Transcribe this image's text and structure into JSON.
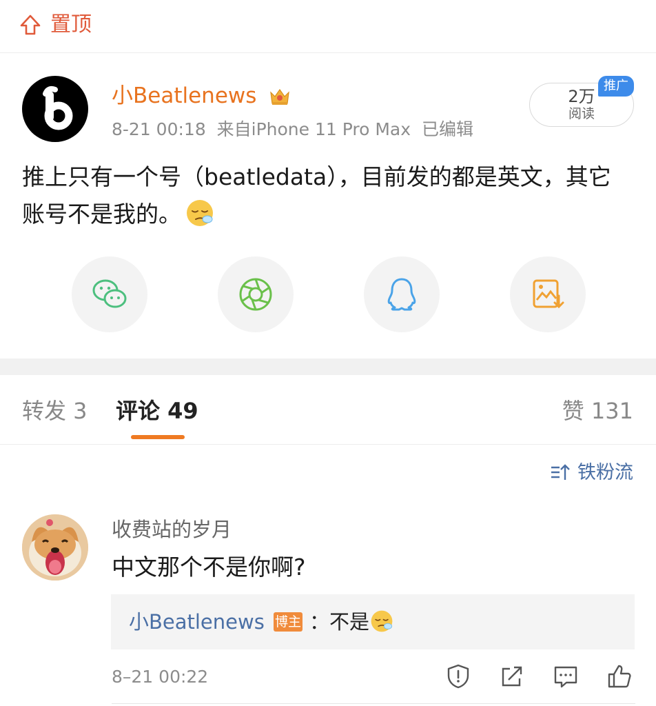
{
  "topbar": {
    "pin_label": "置顶"
  },
  "post": {
    "username": "小Beatlenews",
    "time": "8-21 00:18",
    "source": "来自iPhone 11 Pro Max",
    "edited": "已编辑",
    "views_count": "2万",
    "views_label": "阅读",
    "promo_badge": "推广",
    "body": "推上只有一个号（beatledata），目前发的都是英文，其它账号不是我的。"
  },
  "share": {
    "icons": [
      "wechat-icon",
      "moments-icon",
      "qq-icon",
      "save-image-icon"
    ]
  },
  "tabs": {
    "repost": "转发 3",
    "comments": "评论 49",
    "likes": "赞 131"
  },
  "sort": {
    "label": "铁粉流"
  },
  "comment": {
    "username": "收费站的岁月",
    "text": "中文那个不是你啊?",
    "reply_user": "小Beatlenews",
    "op_badge": "博主",
    "reply_text": "：不是",
    "time": "8–21 00:22",
    "actions": [
      "report-icon",
      "share-icon",
      "reply-icon",
      "like-icon"
    ]
  },
  "colors": {
    "accent_orange": "#e8731f",
    "link_blue": "#4a6fa5",
    "pin_red": "#e05a3a",
    "promo_blue": "#3d8bea"
  }
}
